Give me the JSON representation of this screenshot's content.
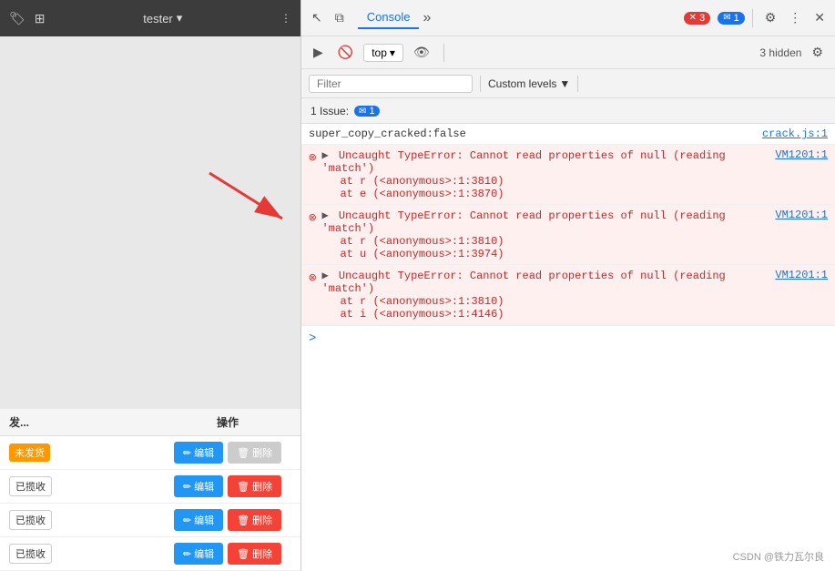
{
  "leftPanel": {
    "topbar": {
      "iconTag": "🏷",
      "iconExpand": "⊞",
      "testerLabel": "tester",
      "moreIcon": "⋮"
    },
    "table": {
      "headers": [
        "发...",
        "操作"
      ],
      "rows": [
        {
          "status": "未发货",
          "statusType": "unshipped",
          "editLabel": "✏ 编辑",
          "deleteLabel": "🗑 删除",
          "deletable": false
        },
        {
          "status": "已揽收",
          "statusType": "received",
          "editLabel": "✏ 编辑",
          "deleteLabel": "🗑 删除",
          "deletable": true
        },
        {
          "status": "已揽收",
          "statusType": "received",
          "editLabel": "✏ 编辑",
          "deleteLabel": "🗑 删除",
          "deletable": true
        },
        {
          "status": "已揽收",
          "statusType": "received",
          "editLabel": "✏ 编辑",
          "deleteLabel": "🗑 删除",
          "deletable": true
        }
      ]
    }
  },
  "devtools": {
    "topbar": {
      "cursorIcon": "↖",
      "framesIcon": "⧉",
      "consoleTab": "Console",
      "moreTabsIcon": "»",
      "errorBadgeCount": "3",
      "messageBadgeCount": "1",
      "settingsIcon": "⚙",
      "moreIcon": "⋮",
      "closeIcon": "✕"
    },
    "consoleToolbar": {
      "executeIcon": "▶",
      "blockIcon": "🚫",
      "topLabel": "top",
      "dropdownArrow": "▾",
      "eyeIcon": "👁",
      "separatorVisible": true,
      "hiddenText": "3 hidden",
      "gearIcon": "⚙"
    },
    "filterBar": {
      "filterPlaceholder": "Filter",
      "customLevelsLabel": "Custom levels",
      "dropdownArrow": "▼"
    },
    "issuesBar": {
      "label": "1 Issue:",
      "badgeCount": "1"
    },
    "consoleLines": [
      {
        "type": "info",
        "text": "super_copy_cracked:false",
        "source": "crack.js:1",
        "hasTriangle": false
      },
      {
        "type": "error",
        "mainText": "Uncaught TypeError: Cannot read properties of null (reading 'match')",
        "stack": [
          "    at r (<anonymous>:1:3810)",
          "    at e (<anonymous>:1:3870)"
        ],
        "source": "VM1201:1",
        "hasTriangle": true
      },
      {
        "type": "error",
        "mainText": "Uncaught TypeError: Cannot read properties of null (reading 'match')",
        "stack": [
          "    at r (<anonymous>:1:3810)",
          "    at u (<anonymous>:1:3974)"
        ],
        "source": "VM1201:1",
        "hasTriangle": true
      },
      {
        "type": "error",
        "mainText": "Uncaught TypeError: Cannot read properties of null (reading 'match')",
        "stack": [
          "    at r (<anonymous>:1:3810)",
          "    at i (<anonymous>:1:4146)"
        ],
        "source": "VM1201:1",
        "hasTriangle": true
      }
    ],
    "promptChevron": ">"
  },
  "watermark": "CSDN @铁力瓦尔良"
}
